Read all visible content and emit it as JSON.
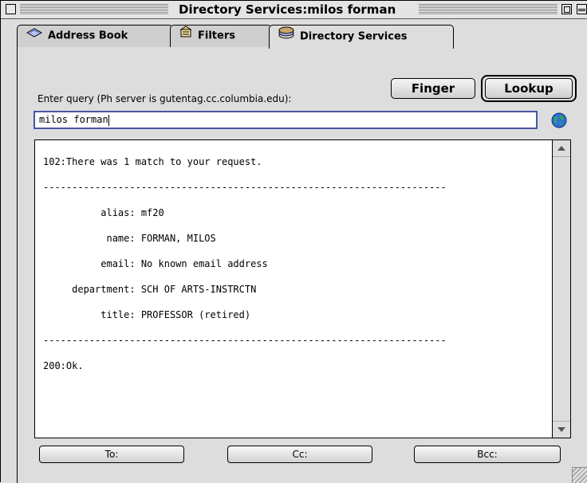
{
  "window": {
    "title": "Directory Services:milos forman"
  },
  "tabs": [
    {
      "label": "Address Book",
      "icon": "address-book-icon"
    },
    {
      "label": "Filters",
      "icon": "filters-icon"
    },
    {
      "label": "Directory Services",
      "icon": "directory-services-icon",
      "active": true
    }
  ],
  "query": {
    "label": "Enter query (Ph server is gutentag.cc.columbia.edu):",
    "value": "milos forman"
  },
  "buttons": {
    "finger": "Finger",
    "lookup": "Lookup"
  },
  "results": {
    "lines": [
      "102:There was 1 match to your request.",
      "----------------------------------------------------------------------",
      "          alias: mf20",
      "           name: FORMAN, MILOS",
      "          email: No known email address",
      "     department: SCH OF ARTS-INSTRCTN",
      "          title: PROFESSOR (retired)",
      "----------------------------------------------------------------------",
      "200:Ok."
    ]
  },
  "address_buttons": {
    "to": "To:",
    "cc": "Cc:",
    "bcc": "Bcc:"
  },
  "colors": {
    "input_focus_border": "#4a56a8",
    "window_bg": "#dddddd"
  }
}
